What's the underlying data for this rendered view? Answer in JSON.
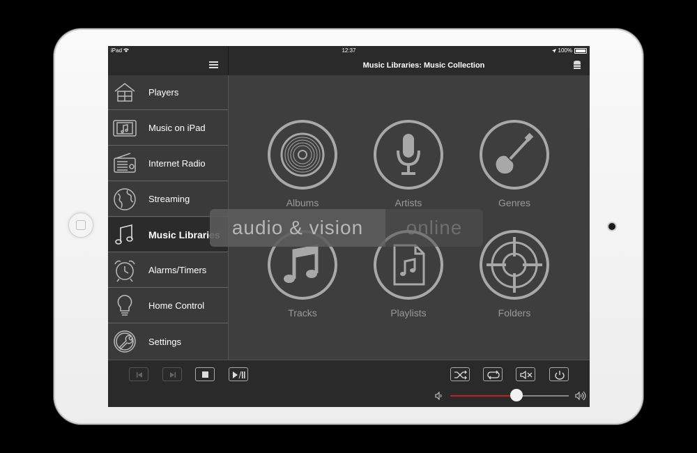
{
  "status": {
    "device": "iPad",
    "time": "12:37",
    "battery": "100%"
  },
  "header": {
    "title": "Music Libraries: Music Collection"
  },
  "sidebar": {
    "items": [
      {
        "label": "Players",
        "icon": "house-icon"
      },
      {
        "label": "Music on iPad",
        "icon": "ipad-music-icon"
      },
      {
        "label": "Internet Radio",
        "icon": "radio-icon"
      },
      {
        "label": "Streaming",
        "icon": "globe-icon"
      },
      {
        "label": "Music Libraries",
        "icon": "music-note-icon",
        "active": true
      },
      {
        "label": "Alarms/Timers",
        "icon": "alarm-clock-icon"
      },
      {
        "label": "Home Control",
        "icon": "lightbulb-icon"
      },
      {
        "label": "Settings",
        "icon": "wrench-icon"
      }
    ]
  },
  "tiles": [
    {
      "label": "Albums",
      "icon": "vinyl-record-icon"
    },
    {
      "label": "Artists",
      "icon": "microphone-icon"
    },
    {
      "label": "Genres",
      "icon": "guitar-icon"
    },
    {
      "label": "Tracks",
      "icon": "music-note-icon"
    },
    {
      "label": "Playlists",
      "icon": "playlist-file-icon"
    },
    {
      "label": "Folders",
      "icon": "target-icon"
    }
  ],
  "watermark": {
    "part1": "audio & vision",
    "part2": "online"
  },
  "playback": {
    "volume": 0.56
  },
  "colors": {
    "accent": "#c02020",
    "background": "#3e3e3e",
    "bar": "#2a2a2a"
  }
}
